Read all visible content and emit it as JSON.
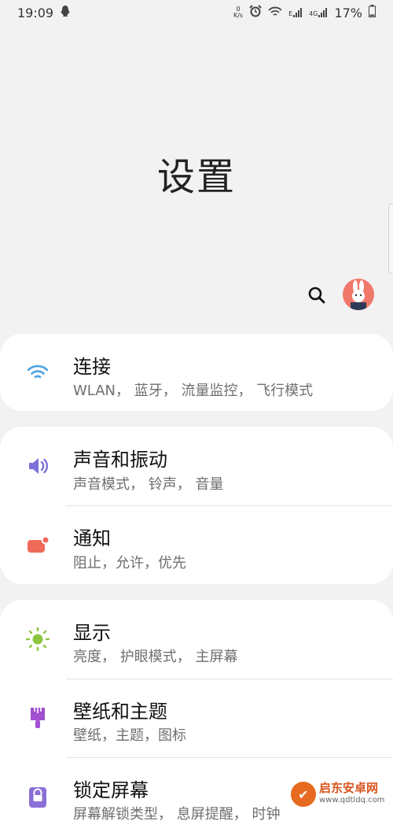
{
  "status_bar": {
    "time": "19:09",
    "net_speed_value": "0",
    "net_speed_unit": "K/s",
    "signal_e": "E",
    "signal_4g": "4G",
    "battery": "17%"
  },
  "page": {
    "title": "设置"
  },
  "header_actions": {
    "search_icon": "search-icon",
    "avatar": "rabbit-avatar"
  },
  "groups": [
    {
      "items": [
        {
          "title": "连接",
          "subtitle": "WLAN， 蓝牙， 流量监控， 飞行模式",
          "icon": "wifi-icon",
          "color": "#4aa3e0"
        }
      ]
    },
    {
      "items": [
        {
          "title": "声音和振动",
          "subtitle": "声音模式， 铃声， 音量",
          "icon": "speaker-icon",
          "color": "#7b6fd9"
        },
        {
          "title": "通知",
          "subtitle": "阻止，允许，优先",
          "icon": "notification-icon",
          "color": "#f06a5a"
        }
      ]
    },
    {
      "items": [
        {
          "title": "显示",
          "subtitle": "亮度， 护眼模式， 主屏幕",
          "icon": "brightness-icon",
          "color": "#8cc63f"
        },
        {
          "title": "壁纸和主题",
          "subtitle": "壁纸，主题，图标",
          "icon": "brush-icon",
          "color": "#a24fd0"
        },
        {
          "title": "锁定屏幕",
          "subtitle": "屏幕解锁类型， 息屏提醒， 时钟",
          "icon": "lock-icon",
          "color": "#8a6fd6"
        }
      ]
    }
  ],
  "watermark": {
    "name": "启东安卓网",
    "url": "www.qdtldq.com"
  }
}
